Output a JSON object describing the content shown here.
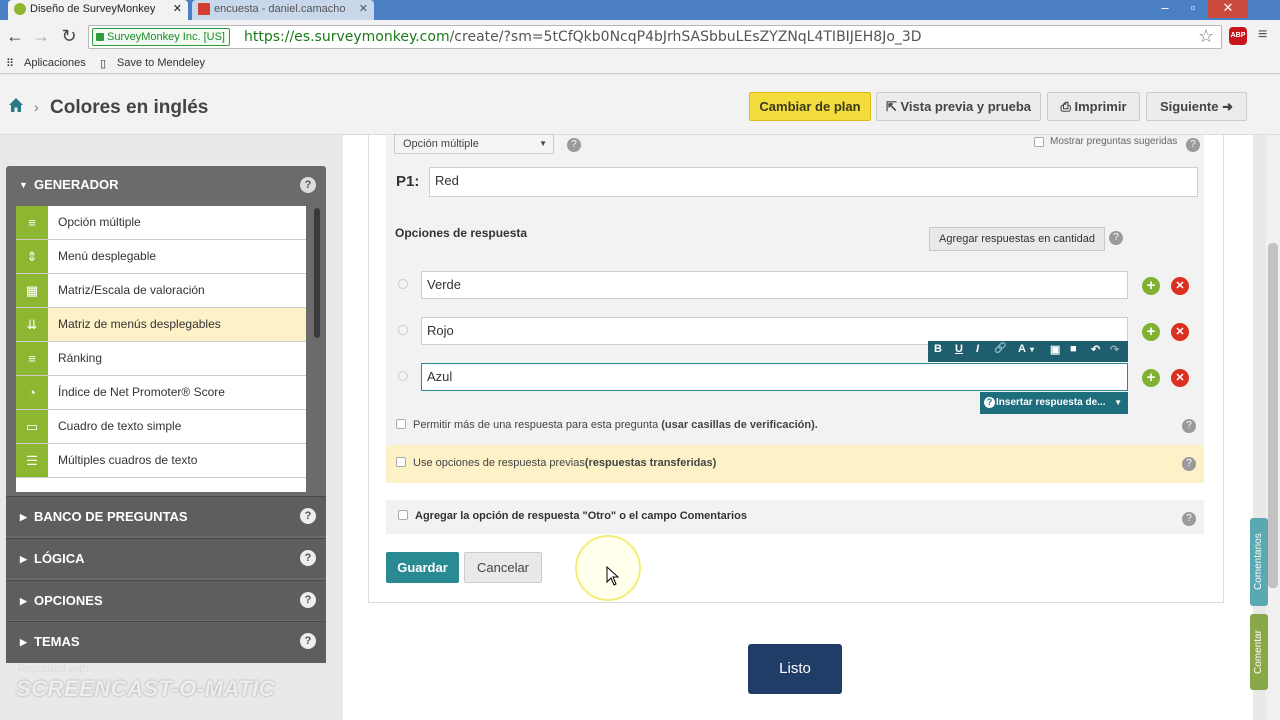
{
  "browser": {
    "tabs": [
      {
        "title": "Diseño de SurveyMonkey",
        "active": true
      },
      {
        "title": "encuesta - daniel.camacho",
        "active": false
      }
    ],
    "secure_label": "SurveyMonkey Inc. [US]",
    "url_host": "https://es.surveymonkey.com",
    "url_path": "/create/?sm=5tCfQkb0NcqP4bJrhSASbbuLEsZYZNqL4TIBIJEH8Jo_3D",
    "bookmarks": [
      "Aplicaciones",
      "Save to Mendeley"
    ]
  },
  "header": {
    "title": "Colores en inglés",
    "buttons": {
      "plan": "Cambiar de plan",
      "preview": "Vista previa y prueba",
      "print": "Imprimir",
      "next": "Siguiente"
    }
  },
  "sidebar": {
    "generator_label": "GENERADOR",
    "question_types": [
      {
        "label": "Opción múltiple",
        "icon": "list-icon",
        "glyph": "≡"
      },
      {
        "label": "Menú desplegable",
        "icon": "dropdown-icon",
        "glyph": "⇕"
      },
      {
        "label": "Matriz/Escala de valoración",
        "icon": "grid-icon",
        "glyph": "▦"
      },
      {
        "label": "Matriz de menús desplegables",
        "icon": "matrix-dropdown-icon",
        "glyph": "⇊"
      },
      {
        "label": "Ránking",
        "icon": "ranking-icon",
        "glyph": "≡"
      },
      {
        "label": "Índice de Net Promoter® Score",
        "icon": "gauge-icon",
        "glyph": "◔"
      },
      {
        "label": "Cuadro de texto simple",
        "icon": "textbox-icon",
        "glyph": "▭"
      },
      {
        "label": "Múltiples cuadros de texto",
        "icon": "multi-textbox-icon",
        "glyph": "☰"
      }
    ],
    "sections": [
      "BANCO DE PREGUNTAS",
      "LÓGICA",
      "OPCIONES",
      "TEMAS"
    ],
    "help_glyph": "?"
  },
  "editor": {
    "question_type": "Opción múltiple",
    "suggest_label": "Mostrar preguntas sugeridas",
    "question_number": "P1:",
    "question_text": "Red",
    "answers_label": "Opciones de respuesta",
    "bulk_button": "Agregar respuestas en cantidad",
    "answers": [
      "Verde",
      "Rojo",
      "Azul"
    ],
    "rich_text_tools": [
      "B",
      "U",
      "I",
      "🔗",
      "A",
      "▾",
      "▣",
      "■",
      "↶",
      "↷"
    ],
    "insert_label": "Insertar respuesta de...",
    "allow_multiple": "Permitir más de una respuesta para esta pregunta",
    "allow_multiple_bold": "(usar casillas de verificación).",
    "transfer_text": "Use opciones de respuesta previas",
    "transfer_bold": "(respuestas transferidas)",
    "other_text": "Agregar la opción de respuesta \"Otro\" o el campo Comentarios",
    "save": "Guardar",
    "cancel": "Cancelar"
  },
  "footer": {
    "done": "Listo"
  },
  "side_tabs": [
    "Comentarios",
    "Comentar"
  ],
  "watermark": {
    "line1": "Recorded with",
    "line2": "SCREENCAST-O-MATIC"
  },
  "colors": {
    "accent_yellow": "#f3dd3d",
    "save_teal": "#2a8a93",
    "done_navy": "#1f3d66",
    "icon_green": "#8db731",
    "delete_red": "#d9301f"
  }
}
